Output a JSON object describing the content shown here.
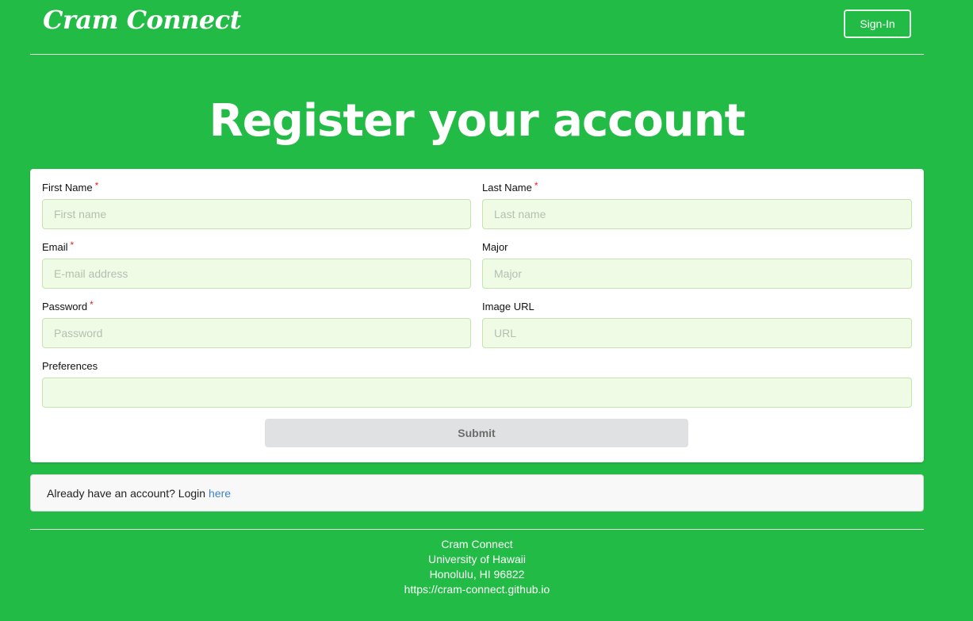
{
  "nav": {
    "brand": "Cram Connect",
    "signin_label": "Sign-In"
  },
  "page": {
    "title": "Register your account"
  },
  "form": {
    "required_mark": "*",
    "fields": {
      "first_name": {
        "label": "First Name",
        "placeholder": "First name",
        "value": "",
        "required": true
      },
      "last_name": {
        "label": "Last Name",
        "placeholder": "Last name",
        "value": "",
        "required": true
      },
      "email": {
        "label": "Email",
        "placeholder": "E-mail address",
        "value": "",
        "required": true
      },
      "major": {
        "label": "Major",
        "placeholder": "Major",
        "value": "",
        "required": false
      },
      "password": {
        "label": "Password",
        "placeholder": "Password",
        "value": "",
        "required": true
      },
      "image_url": {
        "label": "Image URL",
        "placeholder": "URL",
        "value": "",
        "required": false
      },
      "preferences": {
        "label": "Preferences",
        "placeholder": "",
        "value": "",
        "required": false
      }
    },
    "submit_label": "Submit"
  },
  "login_message": {
    "text": "Already have an account? Login",
    "link_text": "here"
  },
  "footer": {
    "line1": "Cram Connect",
    "line2": "University of Hawaii",
    "line3": "Honolulu, HI 96822",
    "line4": "https://cram-connect.github.io"
  },
  "colors": {
    "background": "#21bb45",
    "input_background": "#f0fbe6",
    "required_mark": "#db2828",
    "link": "#4183c4"
  }
}
